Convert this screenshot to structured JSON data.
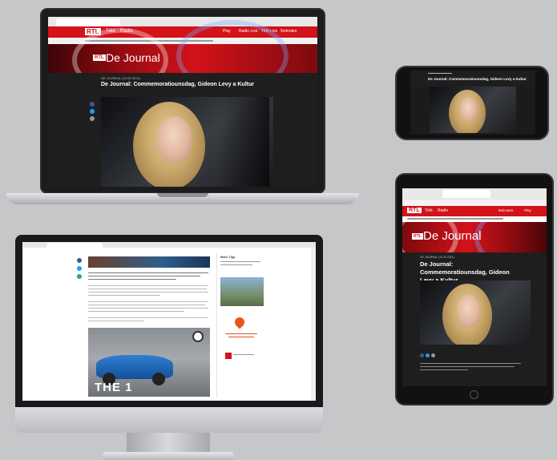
{
  "laptop": {
    "nav_items": [
      "Télé",
      "Radio"
    ],
    "nav_right": [
      "Play",
      "Radio Live",
      "Télé Live",
      "5minutes"
    ],
    "banner_title": "De Journal",
    "article_kicker": "DE JOURNAL (19.02.2021)",
    "article_title": "De Journal: Commemoratiounsdag, Gideon Levy a Kultur"
  },
  "phone": {
    "article_title": "De Journal: Commemoratiounsdag, Gideon Levy a Kultur"
  },
  "tablet": {
    "nav_items": [
      "Télé",
      "Radio"
    ],
    "nav_right": [
      "5minutes",
      "Play"
    ],
    "banner_title": "De Journal",
    "article_kicker": "DE JOURNAL (19.02.2021)",
    "article_title": "De Journal: Commemoratiounsdag, Gideon Levy a Kultur"
  },
  "desktop": {
    "ad_text": "THE 1",
    "sidebar_title": "Mäin Tipp"
  },
  "brand": {
    "logo": "RTL",
    "accent": "#d3121a"
  }
}
